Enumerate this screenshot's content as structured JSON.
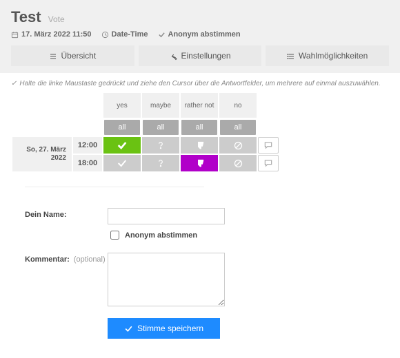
{
  "header": {
    "title": "Test",
    "subtitle": "Vote",
    "date": "17. März 2022 11:50",
    "date_type": "Date-Time",
    "anon": "Anonym abstimmen"
  },
  "tabs": {
    "overview": "Übersicht",
    "settings": "Einstellungen",
    "options": "Wahlmöglichkeiten"
  },
  "hint": "Halte die linke Maustaste gedrückt und ziehe den Cursor über die Antwortfelder, um mehrere auf einmal auszuwählen.",
  "grid": {
    "cols": {
      "yes": "yes",
      "maybe": "maybe",
      "rather_not": "rather not",
      "no": "no"
    },
    "all_label": "all",
    "date_label": "So, 27. März 2022",
    "rows": [
      {
        "time": "12:00",
        "selected": "yes"
      },
      {
        "time": "18:00",
        "selected": "rather_not"
      }
    ]
  },
  "form": {
    "name_label": "Dein Name:",
    "anon_label": "Anonym abstimmen",
    "comment_label": "Kommentar:",
    "optional": "(optional)",
    "submit": "Stimme speichern"
  }
}
